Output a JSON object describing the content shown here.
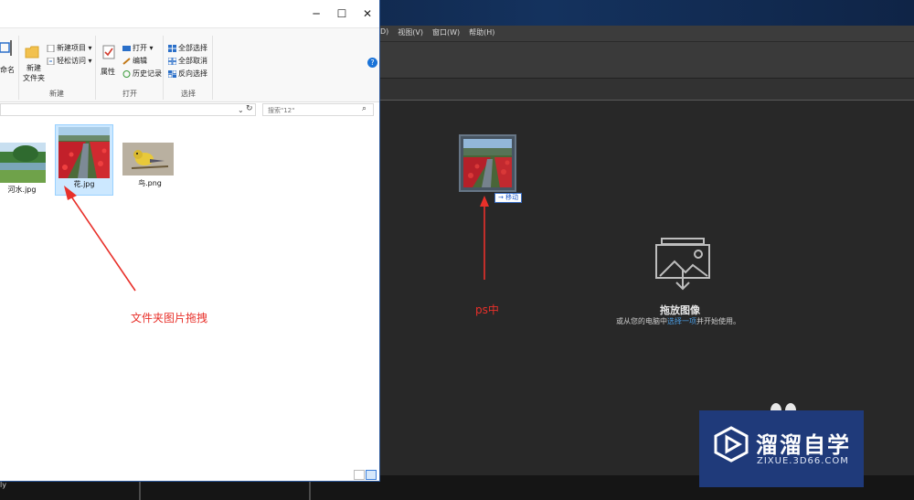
{
  "photoshop": {
    "menu": [
      "D)",
      "视图(V)",
      "窗口(W)",
      "帮助(H)"
    ],
    "drop_title": "拖放图像",
    "drop_sub_prefix": "或从您的电脑中",
    "drop_sub_link": "选择一项",
    "drop_sub_suffix": "并开始使用。",
    "drag_tag": "→ 移动",
    "status_text": "ly"
  },
  "explorer": {
    "window_controls": {
      "minimize": "─",
      "maximize": "☐",
      "close": "✕"
    },
    "help": "?",
    "ribbon": {
      "rename_partial": "命名",
      "new_folder": "新建\n文件夹",
      "new_item": "新建项目 ▾",
      "easy_access": "轻松访问 ▾",
      "group_new": "新建",
      "properties": "属性",
      "open": "打开 ▾",
      "edit": "编辑",
      "history": "历史记录",
      "group_open": "打开",
      "select_all": "全部选择",
      "select_none": "全部取消",
      "invert_select": "反向选择",
      "group_select": "选择"
    },
    "search_placeholder": "搜索\"12\"",
    "files": [
      {
        "name": "河水.jpg",
        "selected": false
      },
      {
        "name": "花.jpg",
        "selected": true
      },
      {
        "name": "鸟.png",
        "selected": false
      }
    ]
  },
  "annotations": {
    "folder_drag": "文件夹图片拖拽",
    "ps": "ps中"
  },
  "watermark": {
    "title": "溜溜自学",
    "url": "ZIXUE.3D66.COM"
  },
  "colors": {
    "annotation_red": "#e8302a",
    "selection_blue": "#cce8ff",
    "link_blue": "#4a9de3",
    "watermark_bg": "#1f3a7a"
  }
}
